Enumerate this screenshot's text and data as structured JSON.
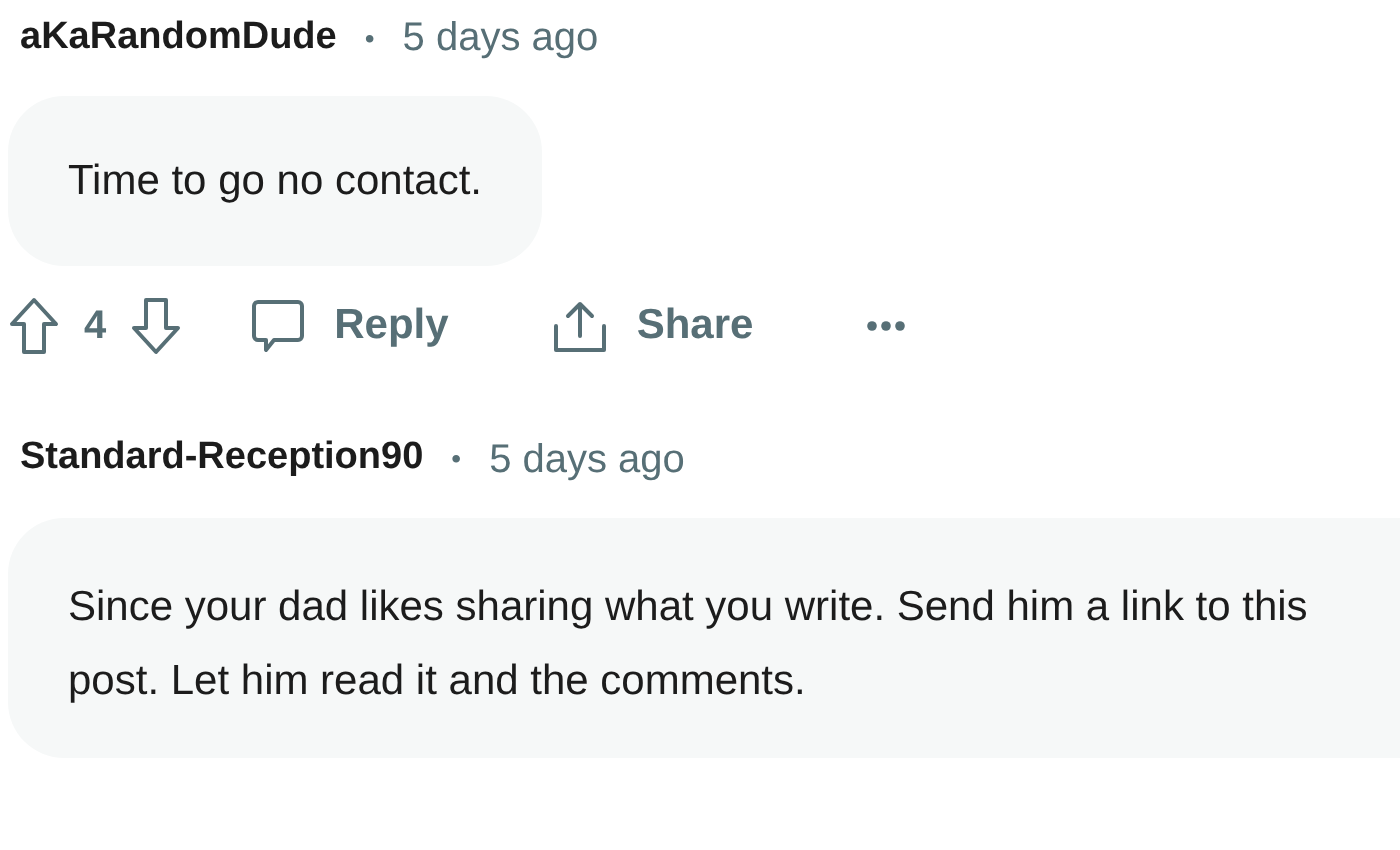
{
  "comments": [
    {
      "author": "aKaRandomDude",
      "separator": "•",
      "time": "5 days ago",
      "body": "Time to go no contact.",
      "actions": {
        "votes": "4",
        "reply": "Reply",
        "share": "Share"
      }
    },
    {
      "author": "Standard-Reception90",
      "separator": "•",
      "time": "5 days ago",
      "body": "Since your dad likes sharing what you write. Send him a link to this post. Let him read it and the comments."
    }
  ]
}
